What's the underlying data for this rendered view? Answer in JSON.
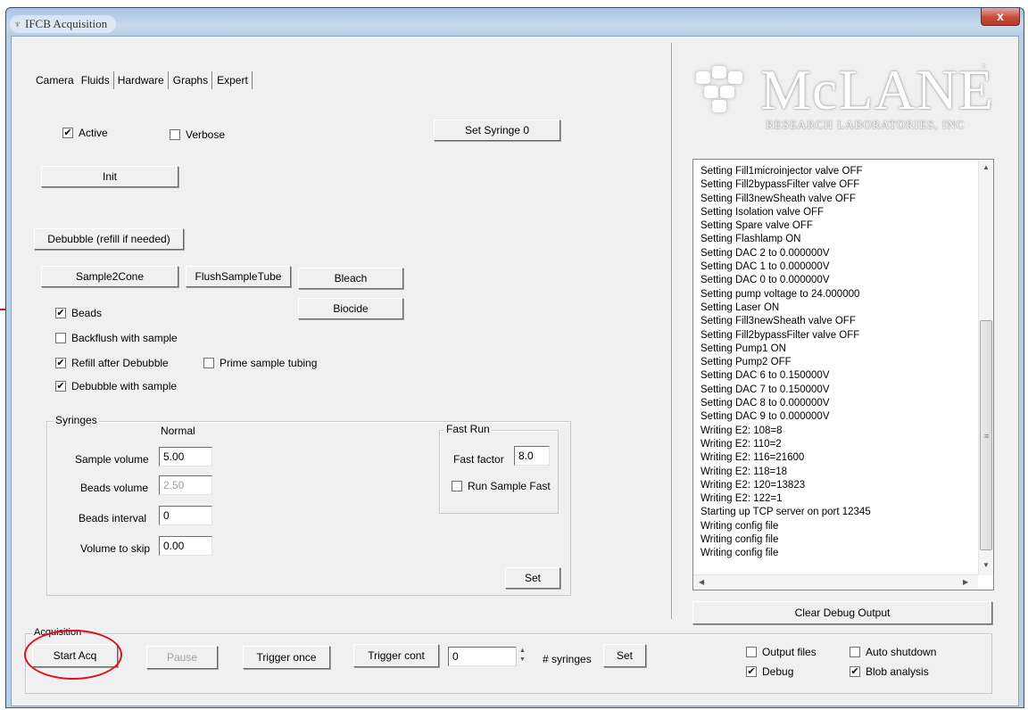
{
  "window": {
    "title": "IFCB Acquisition",
    "close_label": "x"
  },
  "tabs": [
    "Camera",
    "Fluids",
    "Hardware",
    "Graphs",
    "Expert"
  ],
  "fluids": {
    "active_label": "Active",
    "active_checked": true,
    "verbose_label": "Verbose",
    "verbose_checked": false,
    "set_syringe_label": "Set Syringe 0",
    "init_label": "Init",
    "debubble_label": "Debubble (refill if needed)",
    "sample2cone_label": "Sample2Cone",
    "flushsampletube_label": "FlushSampleTube",
    "bleach_label": "Bleach",
    "biocide_label": "Biocide",
    "beads_label": "Beads",
    "beads_checked": true,
    "backflush_label": "Backflush with sample",
    "backflush_checked": false,
    "refill_label": "Refill after Debubble",
    "refill_checked": true,
    "prime_label": "Prime sample tubing",
    "prime_checked": false,
    "debubble_sample_label": "Debubble with sample",
    "debubble_sample_checked": true
  },
  "syringes": {
    "group_label": "Syringes",
    "normal_label": "Normal",
    "sample_volume_label": "Sample volume",
    "sample_volume_value": "5.00",
    "beads_volume_label": "Beads volume",
    "beads_volume_value": "2.50",
    "beads_interval_label": "Beads interval",
    "beads_interval_value": "0",
    "volume_to_skip_label": "Volume to skip",
    "volume_to_skip_value": "0.00",
    "set_label": "Set"
  },
  "fast_run": {
    "group_label": "Fast Run",
    "fast_factor_label": "Fast factor",
    "fast_factor_value": "8.0",
    "run_sample_fast_label": "Run Sample Fast",
    "run_sample_fast_checked": false
  },
  "logo": {
    "word": "McLANE",
    "subtitle": "RESEARCH LABORATORIES, INC",
    "reg": "®"
  },
  "debug": {
    "lines": [
      "Setting Fill1microinjector valve OFF",
      "Setting Fill2bypassFilter valve OFF",
      "Setting Fill3newSheath valve OFF",
      "Setting Isolation valve OFF",
      "Setting Spare valve OFF",
      "Setting Flashlamp ON",
      "Setting DAC 2 to 0.000000V",
      "Setting DAC 1 to 0.000000V",
      "Setting DAC 0 to 0.000000V",
      "Setting pump voltage to 24.000000",
      "Setting Laser ON",
      "Setting Fill3newSheath valve OFF",
      "Setting Fill2bypassFilter valve OFF",
      "Setting Pump1 ON",
      "Setting Pump2 OFF",
      "Setting DAC 6 to 0.150000V",
      "Setting DAC 7 to 0.150000V",
      "Setting DAC 8 to 0.000000V",
      "Setting DAC 9 to 0.000000V",
      "Writing E2: 108=8",
      "Writing E2: 110=2",
      "Writing E2: 116=21600",
      "Writing E2: 118=18",
      "Writing E2: 120=13823",
      "Writing E2: 122=1",
      "Starting up TCP server on port 12345",
      "Writing config file",
      "Writing config file",
      "Writing config file"
    ],
    "clear_label": "Clear Debug Output"
  },
  "acquisition": {
    "group_label": "Acquisition",
    "start_label": "Start Acq",
    "pause_label": "Pause",
    "trigger_once_label": "Trigger once",
    "trigger_cont_label": "Trigger cont",
    "syringes_value": "0",
    "syringes_label": "# syringes",
    "set_label": "Set",
    "output_files_label": "Output files",
    "output_files_checked": false,
    "auto_shutdown_label": "Auto shutdown",
    "auto_shutdown_checked": false,
    "debug_label": "Debug",
    "debug_checked": true,
    "blob_label": "Blob analysis",
    "blob_checked": true
  },
  "annotation_color": "#e0101a"
}
